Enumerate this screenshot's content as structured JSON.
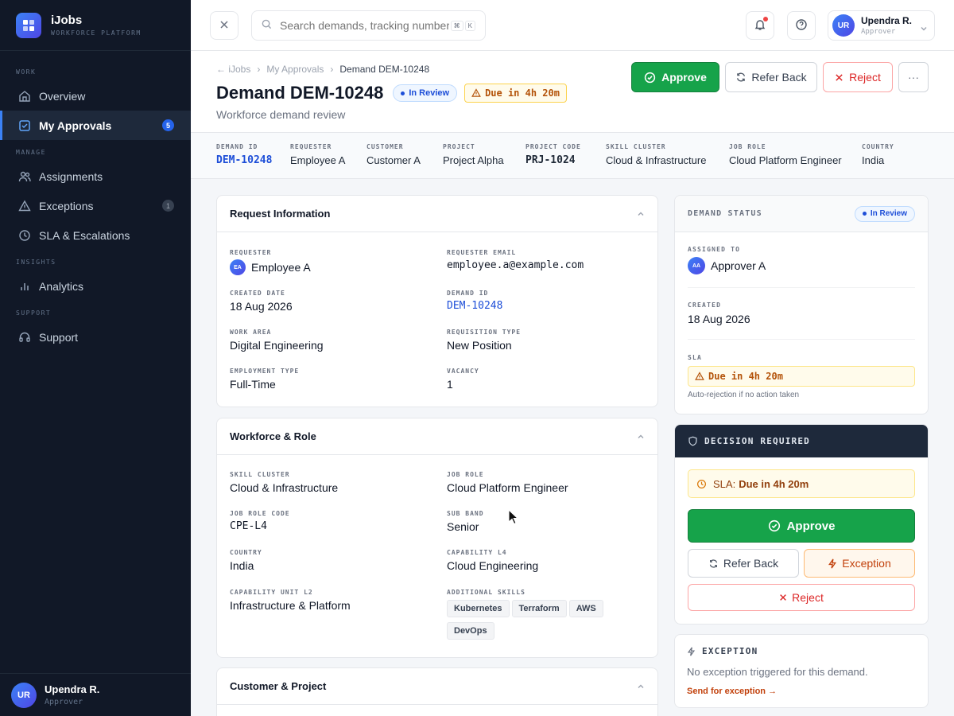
{
  "brand": {
    "name": "iJobs",
    "subtitle": "WORKFORCE PLATFORM"
  },
  "sidebar": {
    "sections": [
      {
        "label": "WORK"
      },
      {
        "label": "MANAGE"
      },
      {
        "label": "INSIGHTS"
      },
      {
        "label": "SUPPORT"
      }
    ],
    "items": [
      {
        "label": "Overview",
        "icon": "home-icon"
      },
      {
        "label": "My Approvals",
        "icon": "checkbox-icon",
        "badge": "5",
        "active": true
      },
      {
        "label": "Assignments",
        "icon": "users-icon"
      },
      {
        "label": "Exceptions",
        "icon": "warning-icon",
        "badge": "1"
      },
      {
        "label": "SLA & Escalations",
        "icon": "clock-icon"
      },
      {
        "label": "Analytics",
        "icon": "bar-chart-icon"
      },
      {
        "label": "Support",
        "icon": "headset-icon"
      }
    ],
    "user": {
      "initials": "UR",
      "name": "Upendra R.",
      "role": "Approver"
    }
  },
  "topbar": {
    "search_placeholder": "Search demands, tracking numbers",
    "shortcut": [
      "⌘",
      "K"
    ],
    "user": {
      "initials": "UR",
      "name": "Upendra R.",
      "role": "Approver"
    }
  },
  "breadcrumb": {
    "back": "iJobs",
    "parent": "My Approvals",
    "current": "Demand DEM-10248"
  },
  "header": {
    "title": "Demand DEM-10248",
    "status": "In Review",
    "due": "Due in 4h 20m",
    "subtitle": "Workforce demand review",
    "actions": {
      "approve": "Approve",
      "refer_back": "Refer Back",
      "reject": "Reject",
      "more": "···"
    }
  },
  "meta": [
    {
      "label": "DEMAND ID",
      "value": "DEM-10248"
    },
    {
      "label": "REQUESTER",
      "value": "Employee A"
    },
    {
      "label": "CUSTOMER",
      "value": "Customer A"
    },
    {
      "label": "PROJECT",
      "value": "Project Alpha"
    },
    {
      "label": "PROJECT CODE",
      "value": "PRJ-1024"
    },
    {
      "label": "SKILL CLUSTER",
      "value": "Cloud & Infrastructure"
    },
    {
      "label": "JOB ROLE",
      "value": "Cloud Platform Engineer"
    },
    {
      "label": "COUNTRY",
      "value": "India"
    }
  ],
  "request_info": {
    "title": "Request Information",
    "requester_label": "REQUESTER",
    "requester_initials": "EA",
    "requester": "Employee A",
    "email_label": "REQUESTER EMAIL",
    "email": "employee.a@example.com",
    "created_label": "CREATED DATE",
    "created": "18 Aug 2026",
    "demand_id_label": "DEMAND ID",
    "demand_id": "DEM-10248",
    "work_area_label": "WORK AREA",
    "work_area": "Digital Engineering",
    "req_type_label": "REQUISITION TYPE",
    "req_type": "New Position",
    "emp_type_label": "EMPLOYMENT TYPE",
    "emp_type": "Full-Time",
    "vacancy_label": "VACANCY",
    "vacancy": "1"
  },
  "workforce": {
    "title": "Workforce & Role",
    "skill_cluster_label": "SKILL CLUSTER",
    "skill_cluster": "Cloud & Infrastructure",
    "job_role_label": "JOB ROLE",
    "job_role": "Cloud Platform Engineer",
    "job_role_code_label": "JOB ROLE CODE",
    "job_role_code": "CPE-L4",
    "sub_band_label": "SUB BAND",
    "sub_band": "Senior",
    "country_label": "COUNTRY",
    "country": "India",
    "cap_l4_label": "CAPABILITY L4",
    "cap_l4": "Cloud Engineering",
    "cap_unit_label": "CAPABILITY UNIT L2",
    "cap_unit": "Infrastructure & Platform",
    "skills_label": "ADDITIONAL SKILLS",
    "skills": [
      "Kubernetes",
      "Terraform",
      "AWS",
      "DevOps"
    ]
  },
  "customer_project": {
    "title": "Customer & Project"
  },
  "demand_status": {
    "title": "DEMAND STATUS",
    "status": "In Review",
    "assigned_label": "ASSIGNED TO",
    "assigned_initials": "AA",
    "assigned": "Approver A",
    "created_label": "CREATED",
    "created": "18 Aug 2026",
    "sla_label": "SLA",
    "sla": "Due in 4h 20m",
    "sla_note": "Auto-rejection if no action taken"
  },
  "decision": {
    "title": "DECISION REQUIRED",
    "sla_prefix": "SLA:",
    "sla_value": "Due in 4h 20m",
    "approve": "Approve",
    "refer_back": "Refer Back",
    "exception": "Exception",
    "reject": "Reject"
  },
  "exception": {
    "title": "EXCEPTION",
    "text": "No exception triggered for this demand.",
    "link": "Send for exception →"
  },
  "colors": {
    "approve": "#16a34a",
    "reject": "#dc2626",
    "accent": "#1d4ed8",
    "warning": "#b45309",
    "sidebar": "#111827"
  }
}
